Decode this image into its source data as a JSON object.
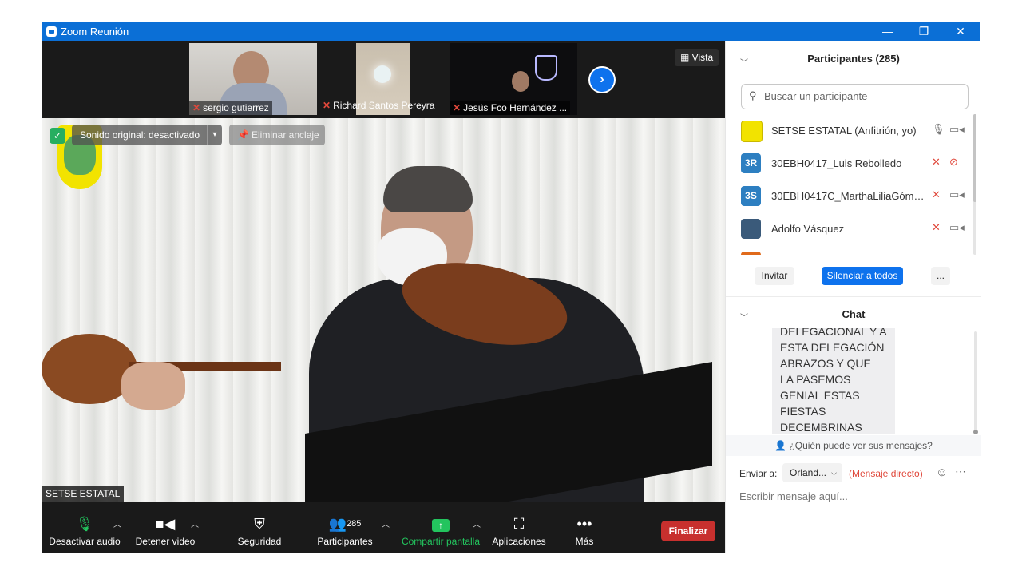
{
  "window": {
    "title": "Zoom Reunión",
    "controls": {
      "minimize": "—",
      "restore": "❐",
      "close": "✕"
    }
  },
  "video": {
    "thumbnails": [
      {
        "name": "sergio gutierrez"
      },
      {
        "name": "Richard Santos Pereyra"
      },
      {
        "name": "Jesús Fco Hernández ..."
      }
    ],
    "view_label": "Vista",
    "sound_label": "Sonido original: desactivado",
    "unpin_label": "Eliminar anclaje",
    "speaker_name": "SETSE ESTATAL"
  },
  "toolbar": {
    "mute_label": "Desactivar audio",
    "video_label": "Detener video",
    "security_label": "Seguridad",
    "participants_label": "Participantes",
    "participants_count": "285",
    "share_label": "Compartir pantalla",
    "apps_label": "Aplicaciones",
    "more_label": "Más",
    "end_label": "Finalizar"
  },
  "participants_panel": {
    "title": "Participantes (285)",
    "search_placeholder": "Buscar un participante",
    "items": [
      {
        "avatar": "",
        "avatar_color": "#f2e300",
        "name": "SETSE ESTATAL (Anfitrión, yo)",
        "muted": false,
        "cam_off": false
      },
      {
        "avatar": "3R",
        "avatar_color": "#2d7fc1",
        "name": "30EBH0417_Luis Rebolledo",
        "muted": true,
        "cam_off": true
      },
      {
        "avatar": "3S",
        "avatar_color": "#2d7fc1",
        "name": "30EBH0417C_MarthaLiliaGómez...",
        "muted": true,
        "cam_off": false
      },
      {
        "avatar": "",
        "avatar_color": "#3a5a7a",
        "name": "Adolfo Vásquez",
        "muted": true,
        "cam_off": false
      }
    ],
    "invite_label": "Invitar",
    "mute_all_label": "Silenciar a todos",
    "more_label": "..."
  },
  "chat": {
    "title": "Chat",
    "message": "DELEGACIONAL Y A ESTA DELEGACIÓN ABRAZOS Y QUE LA PASEMOS GENIAL ESTAS FIESTAS DECEMBRINAS",
    "who_label": "¿Quién puede ver sus mensajes?",
    "send_to_label": "Enviar a:",
    "recipient": "Orland...",
    "direct_label": "(Mensaje directo)",
    "input_placeholder": "Escribir mensaje aquí..."
  }
}
